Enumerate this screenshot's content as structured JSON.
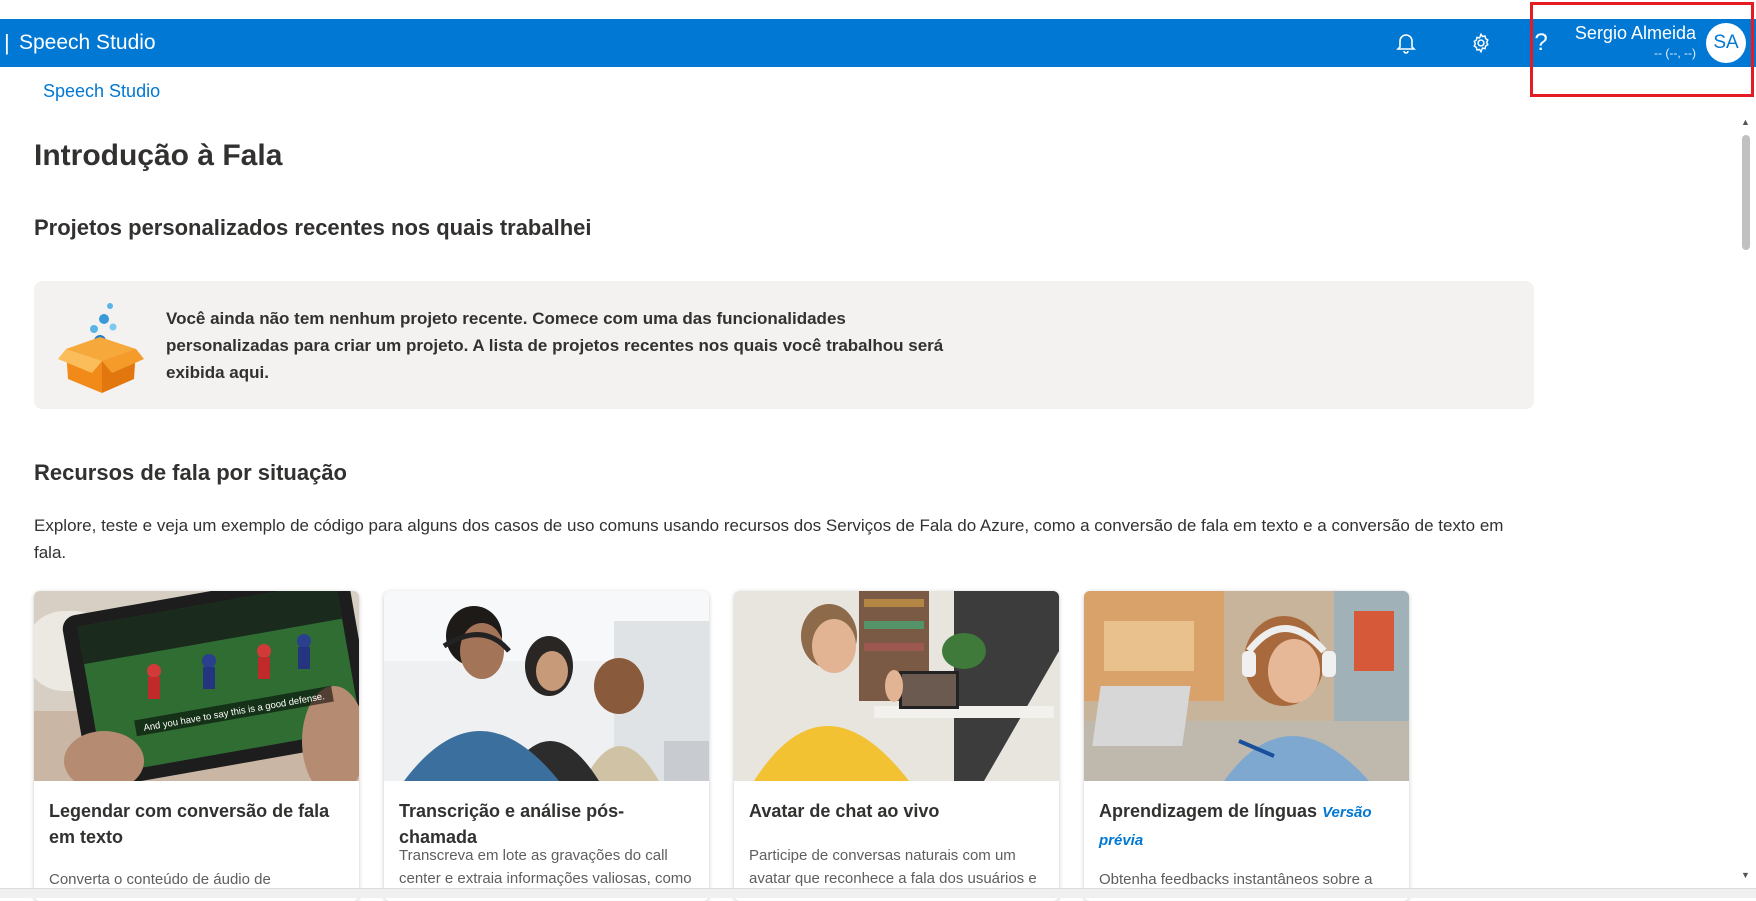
{
  "topbar": {
    "separator": "|",
    "title": "Speech Studio",
    "bell_icon": "bell-icon",
    "settings_icon": "gear-icon",
    "help_label": "?",
    "user": {
      "name": "Sergio Almeida",
      "sub": "-- (--, --)",
      "initials": "SA"
    }
  },
  "breadcrumb": "Speech Studio",
  "page": {
    "title": "Introdução à Fala"
  },
  "recent": {
    "heading": "Projetos personalizados recentes nos quais trabalhei",
    "empty_message": "Você ainda não tem nenhum projeto recente. Comece com uma das funcionalidades personalizadas para criar um projeto. A lista de projetos recentes nos quais você trabalhou será exibida aqui."
  },
  "scenarios": {
    "heading": "Recursos de fala por situação",
    "intro": "Explore, teste e veja um exemplo de código para alguns dos casos de uso comuns usando recursos dos Serviços de Fala do Azure, como a conversão de fala em texto e a conversão de texto em fala.",
    "cards": [
      {
        "title": "Legendar com conversão de fala em texto",
        "badge": "",
        "desc": "Converta o conteúdo de áudio de",
        "image_caption": "And you have to say this is a good defense."
      },
      {
        "title": "Transcrição e análise pós-chamada",
        "badge": "",
        "desc": "Transcreva em lote as gravações do call center e extraia informações valiosas, como"
      },
      {
        "title": "Avatar de chat ao vivo",
        "badge": "",
        "desc": "Participe de conversas naturais com um avatar que reconhece a fala dos usuários e"
      },
      {
        "title": "Aprendizagem de línguas",
        "badge": "Versão prévia",
        "desc": "Obtenha feedbacks instantâneos sobre a"
      }
    ]
  },
  "colors": {
    "brand": "#0078d4",
    "highlight": "#e51b23",
    "panel": "#f3f2f1"
  }
}
